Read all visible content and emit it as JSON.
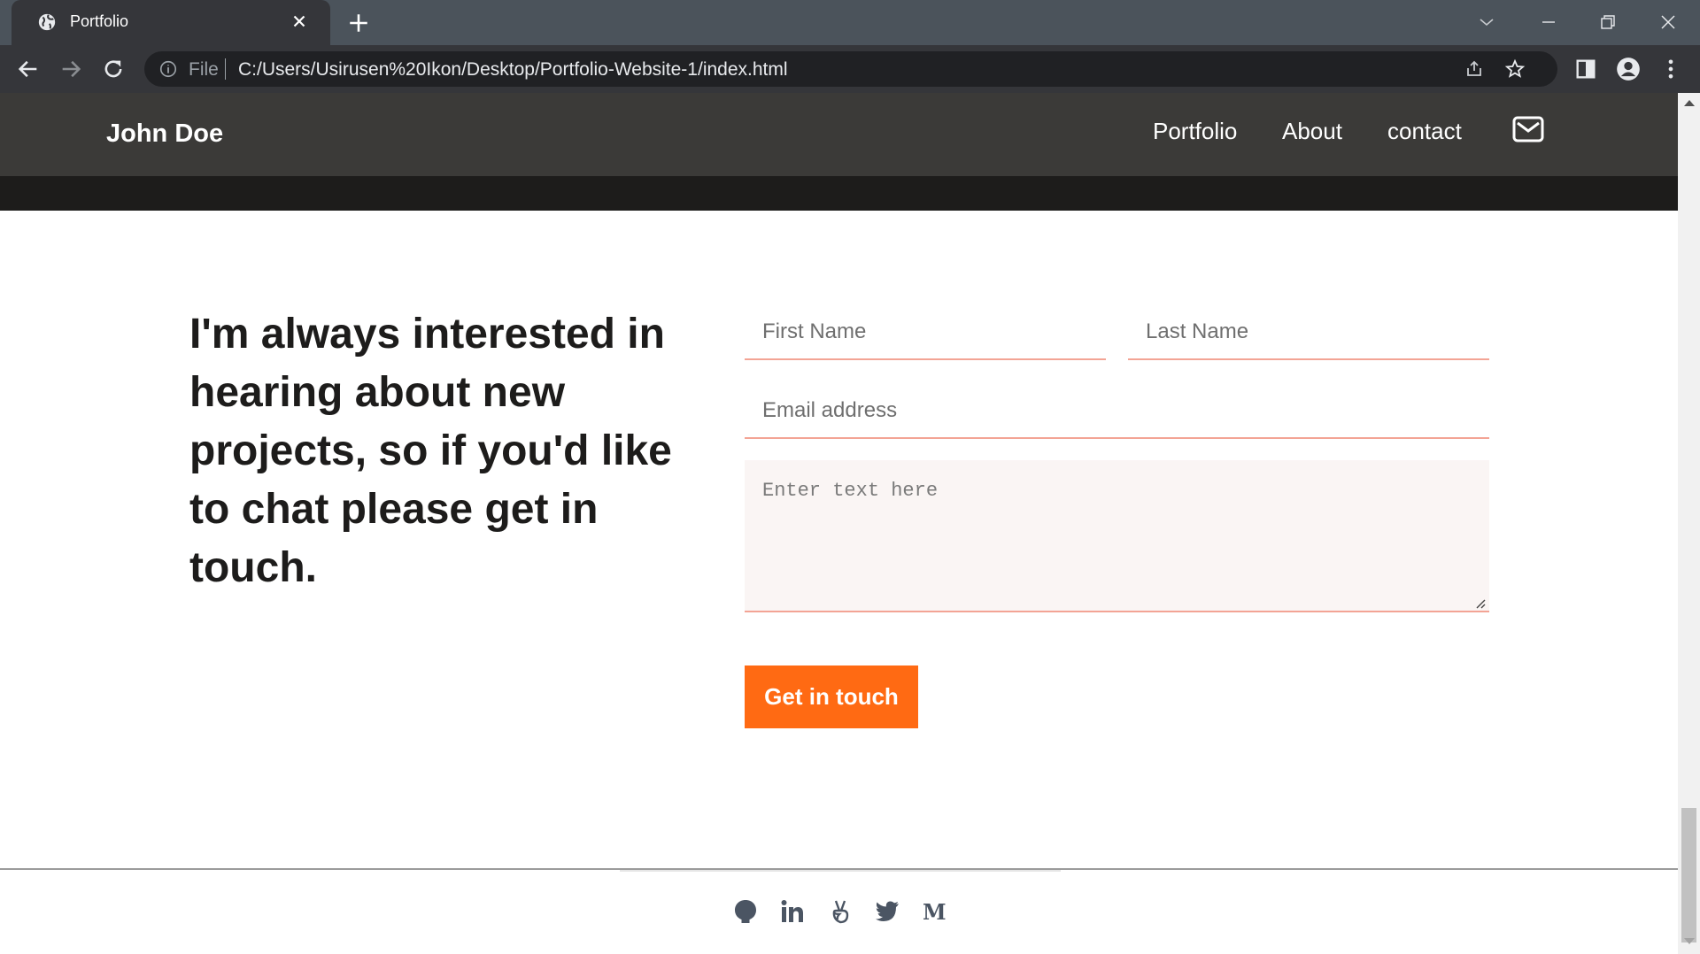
{
  "browser": {
    "tab_title": "Portfolio",
    "url_scheme": "File",
    "url": "C:/Users/Usirusen%20Ikon/Desktop/Portfolio-Website-1/index.html"
  },
  "site": {
    "brand": "John Doe",
    "nav": [
      {
        "label": "Portfolio"
      },
      {
        "label": "About"
      },
      {
        "label": "contact"
      }
    ]
  },
  "contact": {
    "intro": "I'm always interested in hearing about new projects, so if you'd like to chat please get in touch.",
    "first_name_placeholder": "First Name",
    "last_name_placeholder": "Last Name",
    "email_placeholder": "Email address",
    "message_placeholder": "Enter text here",
    "submit_label": "Get in touch"
  },
  "footer": {
    "social_icons": [
      "github-icon",
      "linkedin-icon",
      "angellist-icon",
      "twitter-icon",
      "medium-icon"
    ]
  },
  "colors": {
    "accent": "#ff6a13",
    "header_bg": "#3b3a38",
    "field_underline": "#f3a495"
  }
}
